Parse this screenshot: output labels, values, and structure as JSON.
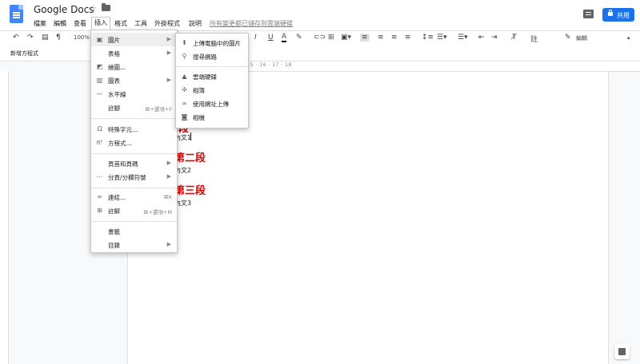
{
  "header": {
    "title": "Google Docs",
    "save_status": "所有變更都已儲存到雲端硬碟",
    "share_label": "共用"
  },
  "menubar": {
    "items": [
      "檔案",
      "編輯",
      "查看",
      "插入",
      "格式",
      "工具",
      "外掛程式",
      "說明"
    ],
    "active": "插入"
  },
  "toolbar": {
    "zoom": "100%",
    "mode_label": "編輯",
    "comment_label": "註"
  },
  "style_bar": {
    "label": "新增方程式"
  },
  "ruler": {
    "marks": "1 · 5 · 6 · 7 · 8 · 9 · 10 · 11 · 12 · 13 · 14 · 15 · 16 · 17 · 18"
  },
  "document": {
    "text_1": "內文1",
    "heading_2": "第二段",
    "text_2": "內文2",
    "heading_3": "第三段",
    "text_3": "內文3"
  },
  "insert_menu": {
    "items": [
      {
        "label": "圖片",
        "icon": "image-icon",
        "shortcut": "",
        "arrow": "▶"
      },
      {
        "label": "表格",
        "icon": "",
        "shortcut": "",
        "arrow": "▶"
      },
      {
        "label": "繪圖...",
        "icon": "drawing-icon",
        "shortcut": "",
        "arrow": ""
      },
      {
        "label": "圖表",
        "icon": "chart-icon",
        "shortcut": "",
        "arrow": "▶"
      },
      {
        "label": "水平線",
        "icon": "horizontal-line-icon",
        "shortcut": "",
        "arrow": ""
      },
      {
        "label": "註腳",
        "icon": "",
        "shortcut": "⌘+選項+F",
        "arrow": ""
      },
      {
        "label": "特殊字元...",
        "icon": "omega-icon",
        "shortcut": "",
        "arrow": ""
      },
      {
        "label": "方程式...",
        "icon": "pi-icon",
        "shortcut": "",
        "arrow": ""
      },
      {
        "label": "頁首和頁碼",
        "icon": "",
        "shortcut": "",
        "arrow": "▶"
      },
      {
        "label": "分頁/分欄符號",
        "icon": "page-break-icon",
        "shortcut": "",
        "arrow": "▶"
      },
      {
        "label": "連結...",
        "icon": "link-icon",
        "shortcut": "⌘K",
        "arrow": ""
      },
      {
        "label": "註解",
        "icon": "add-comment-icon",
        "shortcut": "⌘+選項+M",
        "arrow": ""
      },
      {
        "label": "書籤",
        "icon": "",
        "shortcut": "",
        "arrow": ""
      },
      {
        "label": "目錄",
        "icon": "",
        "shortcut": "",
        "arrow": "▶"
      }
    ]
  },
  "image_submenu": {
    "items": [
      {
        "label": "上傳電腦中的圖片",
        "icon": "upload-icon"
      },
      {
        "label": "搜尋網路",
        "icon": "search-icon"
      },
      {
        "label": "雲端硬碟",
        "icon": "drive-icon"
      },
      {
        "label": "相簿",
        "icon": "photos-icon"
      },
      {
        "label": "使用網址上傳",
        "icon": "link-icon"
      },
      {
        "label": "相機",
        "icon": "camera-icon"
      }
    ]
  },
  "colors": {
    "accent": "#1a73e8",
    "heading": "#d50000",
    "logo": "#4285f4"
  }
}
